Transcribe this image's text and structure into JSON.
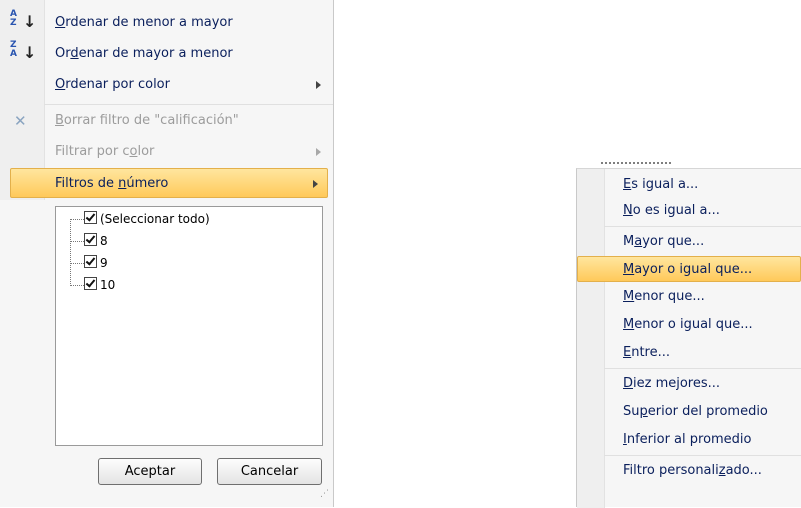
{
  "filter_menu": {
    "items": [
      {
        "pre": "",
        "key": "O",
        "post": "rdenar de menor a mayor",
        "icon": "sort-asc-icon",
        "enabled": true
      },
      {
        "pre": "Or",
        "key": "d",
        "post": "enar de mayor a menor",
        "icon": "sort-desc-icon",
        "enabled": true
      },
      {
        "pre": "",
        "key": "O",
        "post": "rdenar por color",
        "icon": "",
        "enabled": true,
        "submenu": true
      },
      {
        "pre": "",
        "key": "B",
        "post": "orrar filtro de \"calificación\"",
        "icon": "clear-filter-icon",
        "enabled": false
      },
      {
        "pre": "Filtrar por c",
        "key": "o",
        "post": "lor",
        "icon": "",
        "enabled": false,
        "submenu": true
      },
      {
        "pre": "Filtros de ",
        "key": "n",
        "post": "úmero",
        "icon": "",
        "enabled": true,
        "submenu": true,
        "highlighted": true
      }
    ],
    "values": [
      {
        "label": "(Seleccionar todo)",
        "checked": true
      },
      {
        "label": "8",
        "checked": true
      },
      {
        "label": "9",
        "checked": true
      },
      {
        "label": "10",
        "checked": true
      }
    ],
    "accept_label": "Aceptar",
    "cancel_label": "Cancelar",
    "sort_asc_icon": {
      "top": "A",
      "bottom": "Z"
    },
    "sort_desc_icon": {
      "top": "Z",
      "bottom": "A"
    }
  },
  "number_submenu": {
    "items": [
      {
        "pre": "",
        "key": "E",
        "post": "s igual a..."
      },
      {
        "pre": "",
        "key": "N",
        "post": "o es igual a..."
      },
      {
        "pre": "M",
        "key": "a",
        "post": "yor que..."
      },
      {
        "pre": "",
        "key": "M",
        "post": "ayor o igual que...",
        "highlighted": true
      },
      {
        "pre": "",
        "key": "M",
        "post": "enor que..."
      },
      {
        "pre": "",
        "key": "M",
        "post": "enor o igual que..."
      },
      {
        "pre": "",
        "key": "E",
        "post": "ntre..."
      },
      {
        "pre": "",
        "key": "D",
        "post": "iez mejores..."
      },
      {
        "pre": "Su",
        "key": "p",
        "post": "erior del promedio"
      },
      {
        "pre": "",
        "key": "I",
        "post": "nferior al promedio"
      },
      {
        "pre": "Filtro personali",
        "key": "z",
        "post": "ado..."
      }
    ]
  },
  "colors": {
    "highlight": "#ffc95a",
    "text": "#0a1f5c",
    "disabled": "#9c9c9c"
  }
}
